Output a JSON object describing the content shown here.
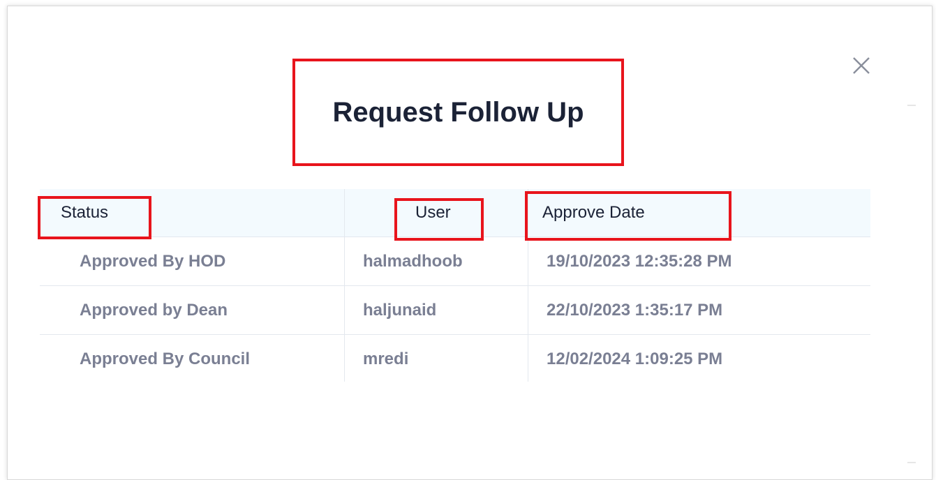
{
  "dialog": {
    "title": "Request Follow Up",
    "close_icon": "close-icon"
  },
  "table": {
    "headers": {
      "status": "Status",
      "user": "User",
      "approve_date": "Approve Date"
    },
    "rows": [
      {
        "status": "Approved By HOD",
        "user": "halmadhoob",
        "approve_date": "19/10/2023 12:35:28 PM"
      },
      {
        "status": "Approved by Dean",
        "user": "haljunaid",
        "approve_date": "22/10/2023 1:35:17 PM"
      },
      {
        "status": "Approved By Council",
        "user": "mredi",
        "approve_date": "12/02/2024 1:09:25 PM"
      }
    ]
  },
  "colors": {
    "highlight": "#e8141c",
    "header_bg": "#f3fafe",
    "title_text": "#1b2236",
    "cell_text": "#7a7f93"
  }
}
